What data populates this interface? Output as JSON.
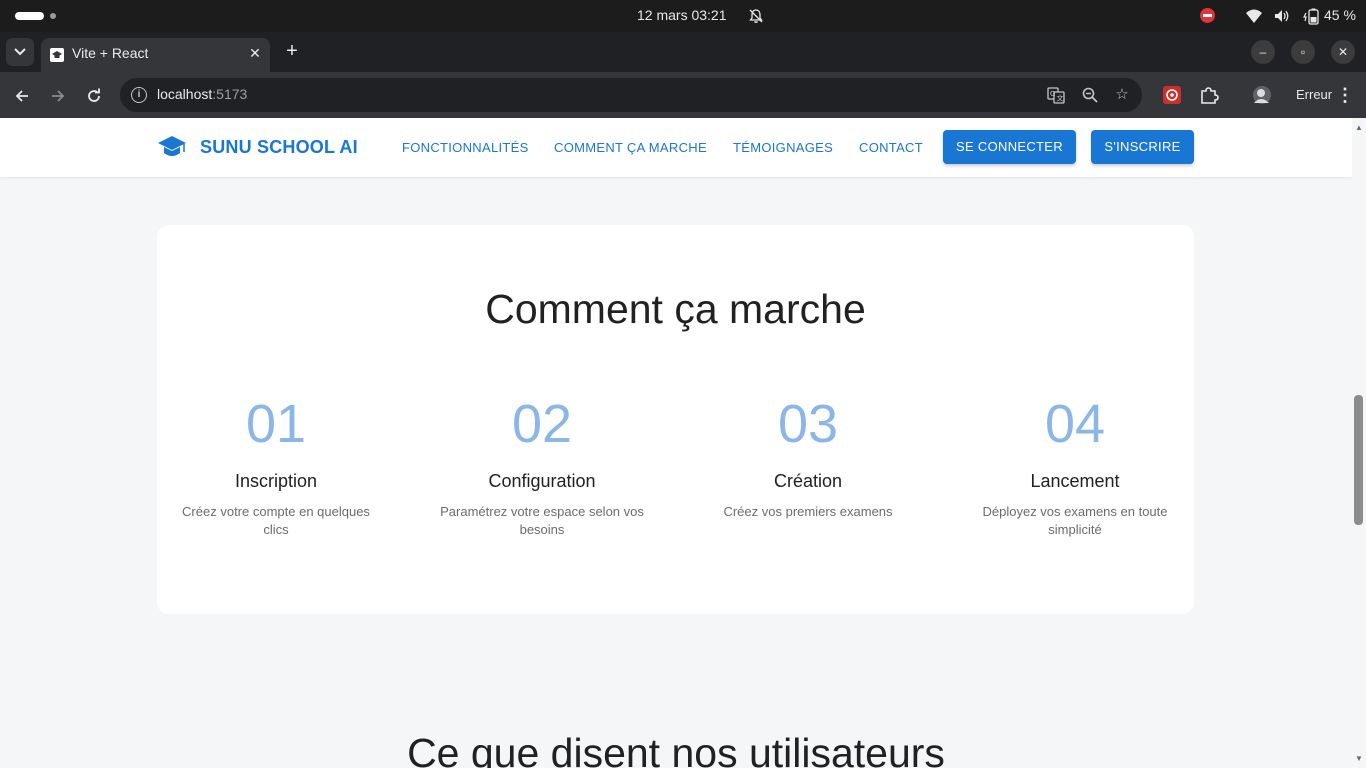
{
  "os": {
    "clock": "12 mars  03:21",
    "battery": "45 %"
  },
  "browser": {
    "tab_title": "Vite + React",
    "url_host": "localhost",
    "url_port": ":5173",
    "profile_status": "Erreur",
    "icons": [
      "tab-menu-icon",
      "close-icon",
      "new-tab-icon",
      "minimize-icon",
      "restore-icon",
      "back-icon",
      "forward-icon",
      "reload-icon",
      "site-info-icon",
      "translate-icon",
      "zoom-icon",
      "bookmark-star-icon",
      "extension-red-icon",
      "extensions-puzzle-icon",
      "profile-avatar-icon",
      "kebab-menu-icon"
    ]
  },
  "page": {
    "brand": "SUNU SCHOOL AI",
    "nav": {
      "features": "FONCTIONNALITÉS",
      "how": "COMMENT ÇA MARCHE",
      "testimonials": "TÉMOIGNAGES",
      "contact": "CONTACT",
      "login": "SE CONNECTER",
      "signup": "S'INSCRIRE"
    },
    "how_section": {
      "title": "Comment ça marche",
      "steps": [
        {
          "number": "01",
          "title": "Inscription",
          "desc_line1": "Créez votre compte en quelques",
          "desc_line2": "clics"
        },
        {
          "number": "02",
          "title": "Configuration",
          "desc_line1": "Paramétrez votre espace selon vos",
          "desc_line2": "besoins"
        },
        {
          "number": "03",
          "title": "Création",
          "desc_line1": "Créez vos premiers examens",
          "desc_line2": ""
        },
        {
          "number": "04",
          "title": "Lancement",
          "desc_line1": "Déployez vos examens en toute",
          "desc_line2": "simplicité"
        }
      ]
    },
    "testimonials_section": {
      "title": "Ce que disent nos utilisateurs"
    }
  },
  "colors": {
    "primary": "#1976d2",
    "step_number": "#8bb6e6",
    "page_bg": "#f5f6f8"
  }
}
